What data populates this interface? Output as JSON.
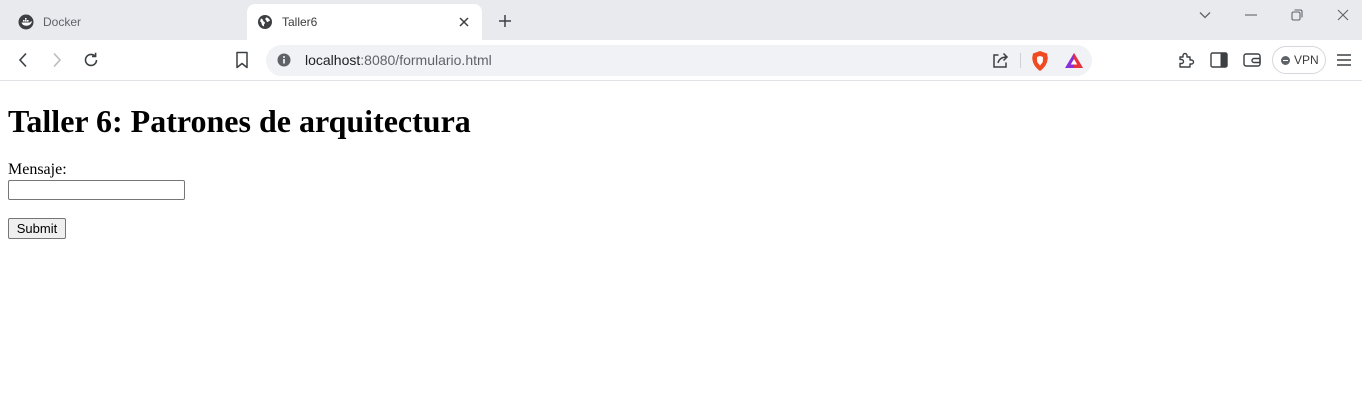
{
  "browser": {
    "tabs": [
      {
        "title": "Docker",
        "active": false
      },
      {
        "title": "Taller6",
        "active": true
      }
    ],
    "address_bar": {
      "host": "localhost",
      "rest": ":8080/formulario.html"
    },
    "vpn_label": "VPN",
    "accent_colors": {
      "brave_shield": "#f04a22",
      "rewards_triangle": "#8b2fd9"
    }
  },
  "page": {
    "heading": "Taller 6: Patrones de arquitectura",
    "form": {
      "message_label": "Mensaje:",
      "message_value": "",
      "submit_label": "Submit"
    }
  },
  "icons": [
    "docker-icon",
    "globe-icon",
    "close-icon",
    "plus-icon",
    "chevron-down-icon",
    "minimize-icon",
    "restore-icon",
    "window-close-icon",
    "back-icon",
    "forward-icon",
    "reload-icon",
    "bookmark-icon",
    "info-icon",
    "share-icon",
    "brave-shield-icon",
    "rewards-icon",
    "extensions-icon",
    "sidebar-icon",
    "wallet-icon",
    "menu-icon"
  ]
}
